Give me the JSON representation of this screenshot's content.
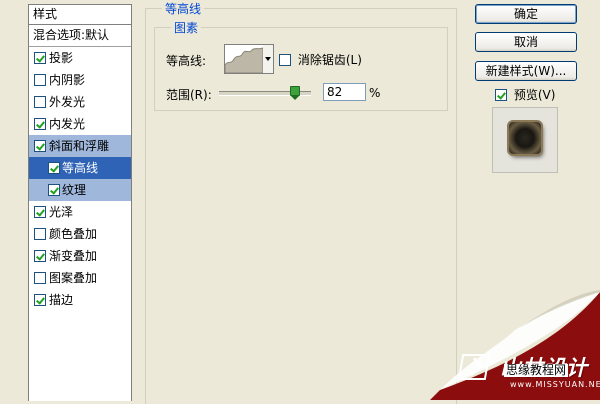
{
  "style_panel": {
    "header": "样式",
    "blend_options": "混合选项:默认",
    "items": [
      {
        "label": "投影",
        "checked": true
      },
      {
        "label": "内阴影",
        "checked": false
      },
      {
        "label": "外发光",
        "checked": false
      },
      {
        "label": "内发光",
        "checked": true
      },
      {
        "label": "斜面和浮雕",
        "checked": true
      },
      {
        "label": "等高线",
        "checked": true
      },
      {
        "label": "纹理",
        "checked": true
      },
      {
        "label": "光泽",
        "checked": true
      },
      {
        "label": "颜色叠加",
        "checked": false
      },
      {
        "label": "渐变叠加",
        "checked": true
      },
      {
        "label": "图案叠加",
        "checked": false
      },
      {
        "label": "描边",
        "checked": true
      }
    ]
  },
  "contour_panel": {
    "title": "等高线",
    "group_title": "图素",
    "contour_label": "等高线:",
    "antialias_label": "消除锯齿(L)",
    "antialias_checked": false,
    "range_label": "范围(R):",
    "range_value": "82",
    "range_unit": "%",
    "range_fraction": 0.82
  },
  "buttons": {
    "ok": "确定",
    "cancel": "取消",
    "new_style": "新建样式(W)...",
    "preview_label": "预览(V)",
    "preview_checked": true
  },
  "watermark": {
    "title": "山林设计",
    "subtitle": "思缘教程网",
    "url": "www.MISSYUAN.NET"
  },
  "colors": {
    "dialog_bg": "#ece9d8",
    "selection_dark": "#2f63b5",
    "selection_light": "#9fb7db",
    "group_title": "#0046d5",
    "curl_red": "#8c0d0d"
  }
}
